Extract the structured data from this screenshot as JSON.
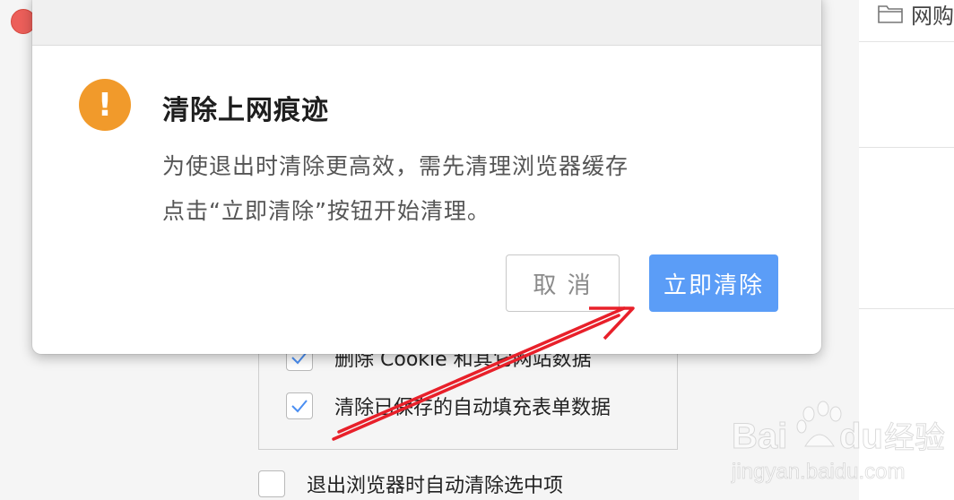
{
  "background": {
    "right_panel": {
      "folder_label": "网购"
    },
    "options": [
      {
        "label": "删除 Cookie 和其它网站数据",
        "checked": true
      },
      {
        "label": "清除已保存的自动填充表单数据",
        "checked": true
      }
    ],
    "auto_clear": {
      "label": "退出浏览器时自动清除选中项",
      "checked": false
    }
  },
  "dialog": {
    "title": "清除上网痕迹",
    "icon": "warning-icon",
    "icon_glyph": "!",
    "message_line1": "为使退出时清除更高效，需先清理浏览器缓存",
    "message_line2": "点击“立即清除”按钮开始清理。",
    "cancel_label": "取 消",
    "confirm_label": "立即清除"
  },
  "colors": {
    "warning": "#f19a2b",
    "primary": "#5b9df7",
    "close_button": "#ec5f5a",
    "annotation_arrow": "#e8202a"
  }
}
